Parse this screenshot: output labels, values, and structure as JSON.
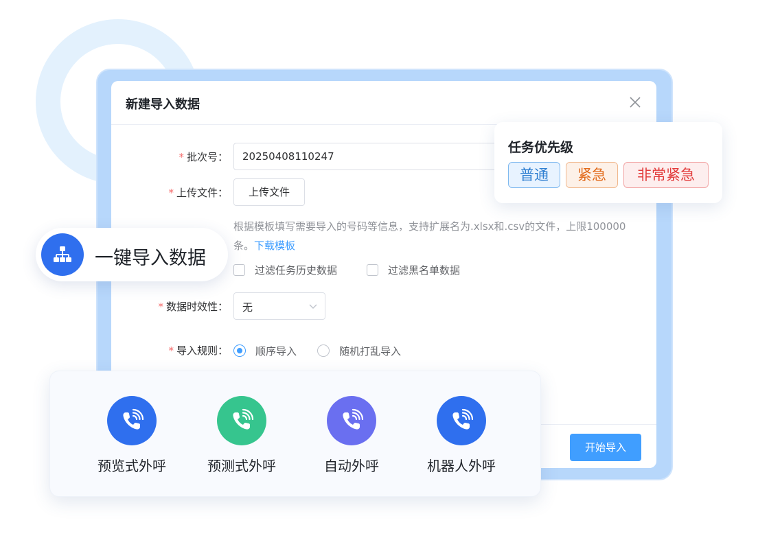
{
  "dialog": {
    "title": "新建导入数据",
    "fields": {
      "batch_label": "批次号：",
      "batch_value": "20250408110247",
      "upload_label": "上传文件：",
      "upload_button": "上传文件",
      "hint_text": "根据模板填写需要导入的号码等信息，支持扩展名为.xlsx和.csv的文件，上限100000条。",
      "hint_link": "下载模板",
      "filter_history": "过滤任务历史数据",
      "filter_blacklist": "过滤黑名单数据",
      "validity_label": "数据时效性：",
      "validity_value": "无",
      "rule_label": "导入规则：",
      "rule_sequential": "顺序导入",
      "rule_random": "随机打乱导入"
    },
    "submit_button": "开始导入"
  },
  "priority": {
    "title": "任务优先级",
    "tags": [
      "普通",
      "紧急",
      "非常紧急"
    ]
  },
  "feature_pill": {
    "label": "一键导入数据"
  },
  "call_modes": [
    {
      "label": "预览式外呼",
      "color": "#2f6fee"
    },
    {
      "label": "预测式外呼",
      "color": "#36c58e"
    },
    {
      "label": "自动外呼",
      "color": "#6a6ff0"
    },
    {
      "label": "机器人外呼",
      "color": "#2f6fee"
    }
  ],
  "colors": {
    "primary": "#409eff",
    "required_star": "#f56c6c"
  }
}
